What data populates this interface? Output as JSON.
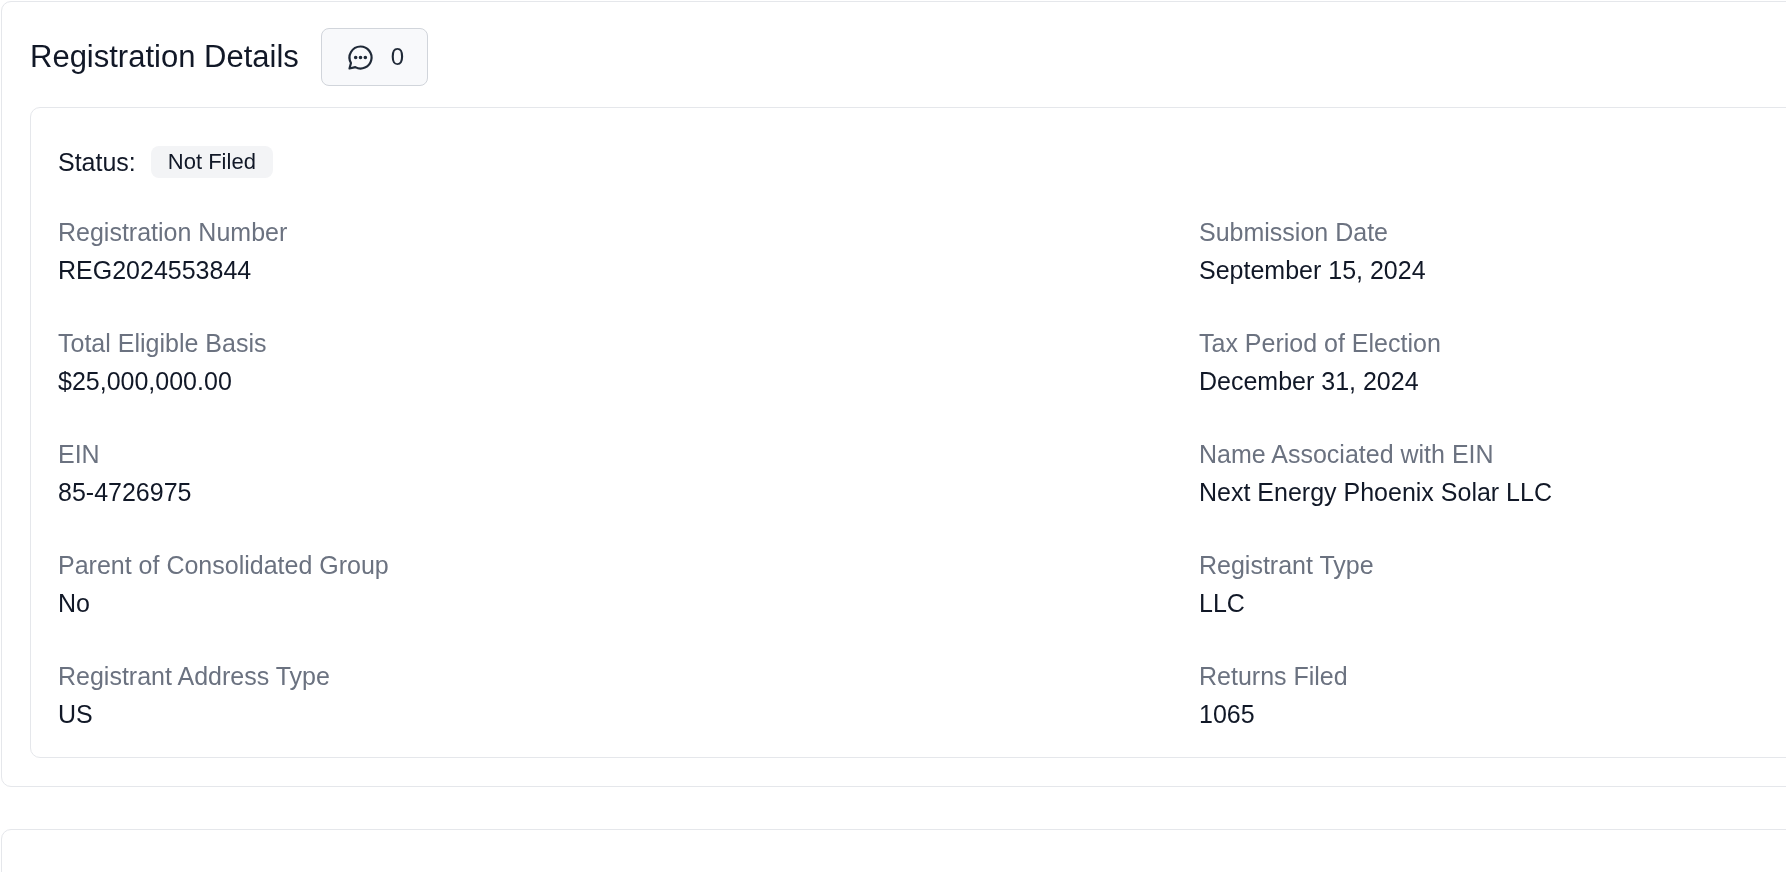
{
  "header": {
    "title": "Registration Details",
    "comments_button": {
      "count": "0"
    }
  },
  "status": {
    "label": "Status:",
    "badge": "Not Filed"
  },
  "fields": [
    {
      "label": "Registration Number",
      "value": "REG2024553844"
    },
    {
      "label": "Submission Date",
      "value": "September 15, 2024"
    },
    {
      "label": "Total Eligible Basis",
      "value": "$25,000,000.00"
    },
    {
      "label": "Tax Period of Election",
      "value": "December 31, 2024"
    },
    {
      "label": "EIN",
      "value": "85-4726975"
    },
    {
      "label": "Name Associated with EIN",
      "value": "Next Energy Phoenix Solar LLC"
    },
    {
      "label": "Parent of Consolidated Group",
      "value": "No"
    },
    {
      "label": "Registrant Type",
      "value": "LLC"
    },
    {
      "label": "Registrant Address Type",
      "value": "US"
    },
    {
      "label": "Returns Filed",
      "value": "1065"
    }
  ]
}
